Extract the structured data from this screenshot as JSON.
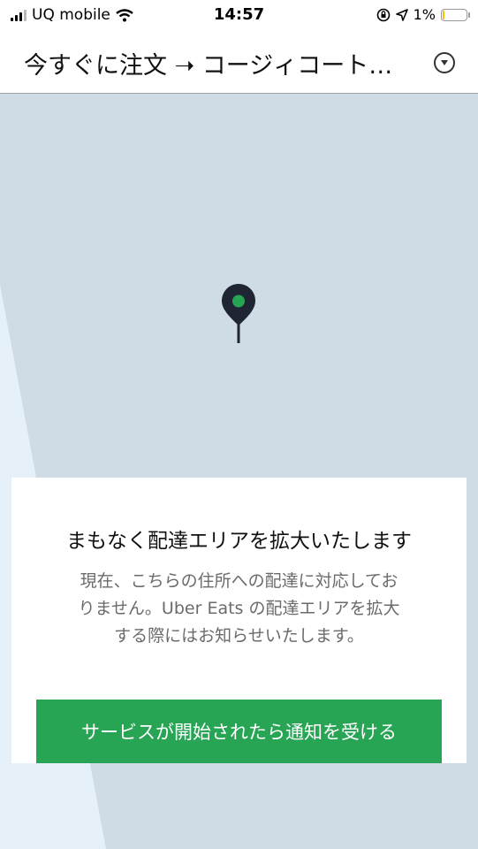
{
  "status_bar": {
    "carrier": "UQ mobile",
    "time": "14:57",
    "battery": "1%",
    "battery_level": 0.01
  },
  "header": {
    "title": "今すぐに注文 ➝ コージィコート…",
    "dropdown_icon": "chevron-down-circle-icon"
  },
  "map": {
    "pin_icon": "location-pin-icon",
    "pin_color": "#1f2533",
    "pin_dot_color": "#27a554"
  },
  "card": {
    "title": "まもなく配達エリアを拡大いたします",
    "body_line1": "現在、こちらの住所への配達に対応してお",
    "body_line2": "りません。Uber Eats の配達エリアを拡大",
    "body_line3": "する際にはお知らせいたします。",
    "button_label": "サービスが開始されたら通知を受ける",
    "button_color": "#27a554"
  }
}
